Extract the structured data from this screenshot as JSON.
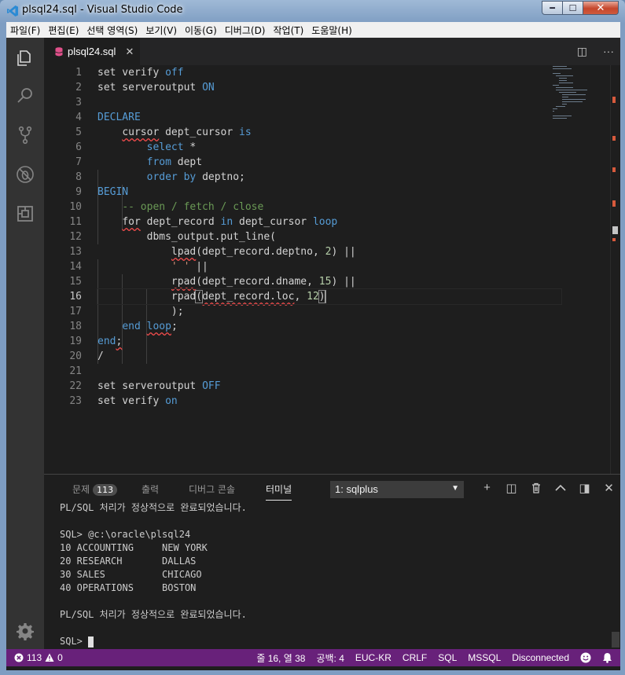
{
  "window": {
    "title": "plsql24.sql - Visual Studio Code",
    "minimize": "━",
    "maximize": "☐",
    "close": "✕"
  },
  "menu": [
    "파일(F)",
    "편집(E)",
    "선택 영역(S)",
    "보기(V)",
    "이동(G)",
    "디버그(D)",
    "작업(T)",
    "도움말(H)"
  ],
  "activity_icons": [
    "explorer-icon",
    "search-icon",
    "source-control-icon",
    "debug-icon",
    "extensions-icon",
    "settings-gear-icon"
  ],
  "tab": {
    "label": "plsql24.sql",
    "close": "✕"
  },
  "editor_actions": {
    "split": "◫",
    "more": "···"
  },
  "editor": {
    "active_line": 16,
    "line_numbers": [
      "1",
      "2",
      "3",
      "4",
      "5",
      "6",
      "7",
      "8",
      "9",
      "10",
      "11",
      "12",
      "13",
      "14",
      "15",
      "16",
      "17",
      "18",
      "19",
      "20",
      "21",
      "22",
      "23"
    ]
  },
  "panel": {
    "tabs": [
      {
        "label": "문제",
        "badge": "113"
      },
      {
        "label": "출력"
      },
      {
        "label": "디버그 콘솔"
      },
      {
        "label": "터미널",
        "active": true
      }
    ],
    "terminal_select": "1: sqlplus",
    "actions": {
      "add": "+",
      "split": "◫",
      "kill": "🗑",
      "maximize": "^",
      "toggle": "◨",
      "close": "✕"
    },
    "terminal_lines": [
      "PL/SQL 처리가 정상적으로 완료되었습니다.",
      "",
      "SQL> @c:\\oracle\\plsql24",
      "10 ACCOUNTING     NEW YORK",
      "20 RESEARCH       DALLAS",
      "30 SALES          CHICAGO",
      "40 OPERATIONS     BOSTON",
      "",
      "PL/SQL 처리가 정상적으로 완료되었습니다.",
      "",
      "SQL> "
    ]
  },
  "statusbar": {
    "errors": "113",
    "warnings": "0",
    "position": "줄 16, 열 38",
    "spaces": "공백: 4",
    "encoding": "EUC-KR",
    "eol": "CRLF",
    "language": "SQL",
    "dialect": "MSSQL",
    "connection": "Disconnected"
  },
  "colors": {
    "statusbar": "#68217a",
    "editor_bg": "#1e1e1e",
    "keyword": "#569cd6",
    "number": "#b5cea8",
    "comment": "#6a9955"
  }
}
